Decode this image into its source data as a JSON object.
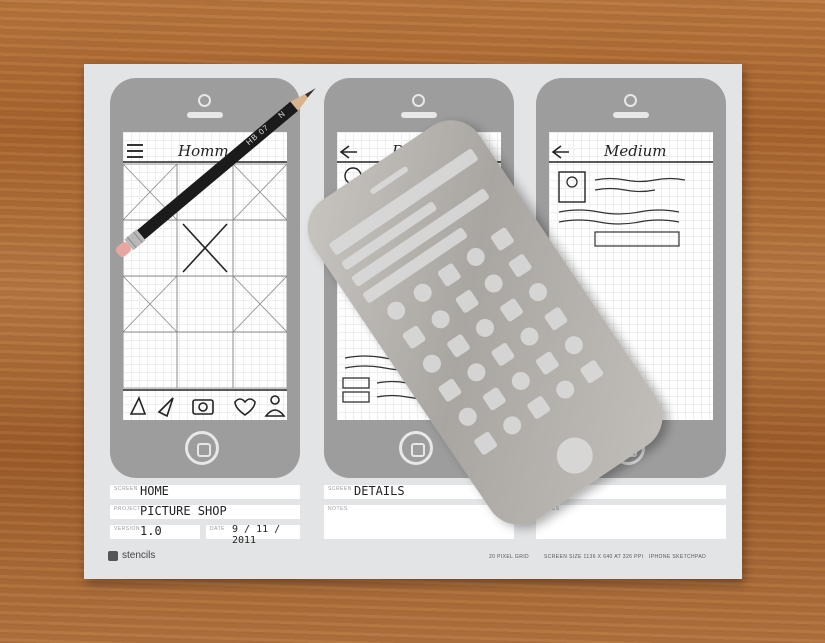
{
  "screens": [
    {
      "title": "Homm"
    },
    {
      "title": "Details"
    },
    {
      "title": "Medium"
    }
  ],
  "pencil": {
    "text": "HB 07",
    "logo": "N"
  },
  "pad": {
    "brand": "stencils",
    "fields": {
      "screen_value": "HOME",
      "screen2_value": "DETAILS",
      "project_value": "PICTURE SHOP",
      "version_value": "1.0",
      "date_value": "9 / 11 / 2011"
    },
    "footer": {
      "grid": "20 PIXEL GRID",
      "screen_size": "SCREEN SIZE 1136 X 640 AT 326 PPI",
      "pad_name": "IPHONE SKETCHPAD"
    }
  }
}
